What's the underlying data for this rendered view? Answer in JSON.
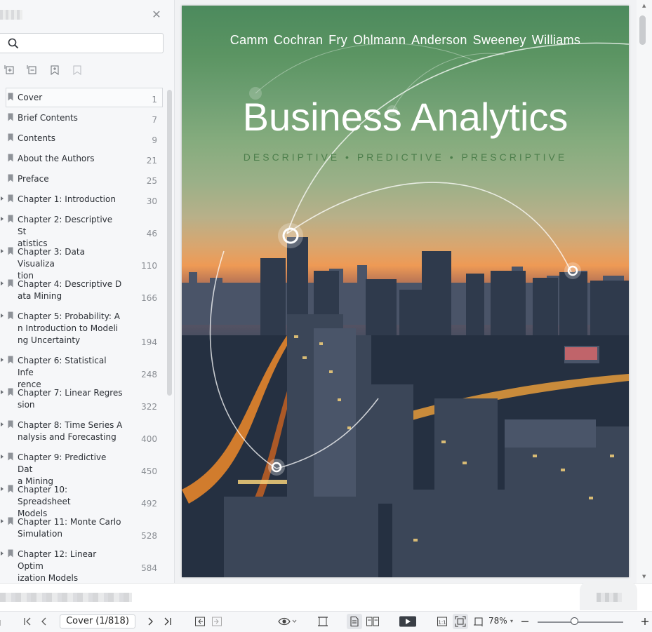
{
  "sidebar": {
    "search": {
      "value": "",
      "placeholder": ""
    },
    "outline": [
      {
        "label": "Cover",
        "page": "1",
        "expandable": false,
        "selected": true,
        "lines": 1
      },
      {
        "label": "Brief Contents",
        "page": "7",
        "expandable": false,
        "lines": 1
      },
      {
        "label": "Contents",
        "page": "9",
        "expandable": false,
        "lines": 1
      },
      {
        "label": "About the Authors",
        "page": "21",
        "expandable": false,
        "lines": 1
      },
      {
        "label": "Preface",
        "page": "25",
        "expandable": false,
        "lines": 1
      },
      {
        "label": "Chapter 1: Introduction",
        "page": "30",
        "expandable": true,
        "lines": 1
      },
      {
        "label": "Chapter 2: Descriptive St\natistics",
        "page": "46",
        "expandable": true,
        "lines": 2
      },
      {
        "label": "Chapter 3: Data Visualiza\ntion",
        "page": "110",
        "expandable": true,
        "lines": 2
      },
      {
        "label": "Chapter 4: Descriptive D\nata Mining",
        "page": "166",
        "expandable": true,
        "lines": 2
      },
      {
        "label": "Chapter 5: Probability: A\nn Introduction to Modeli\nng Uncertainty",
        "page": "194",
        "expandable": true,
        "lines": 3
      },
      {
        "label": "Chapter 6: Statistical Infe\nrence",
        "page": "248",
        "expandable": true,
        "lines": 2
      },
      {
        "label": "Chapter 7: Linear Regres\nsion",
        "page": "322",
        "expandable": true,
        "lines": 2
      },
      {
        "label": "Chapter 8: Time Series A\nnalysis and Forecasting",
        "page": "400",
        "expandable": true,
        "lines": 2
      },
      {
        "label": "Chapter 9: Predictive Dat\na Mining",
        "page": "450",
        "expandable": true,
        "lines": 2
      },
      {
        "label": "Chapter 10: Spreadsheet\nModels",
        "page": "492",
        "expandable": true,
        "lines": 2
      },
      {
        "label": "Chapter 11: Monte Carlo\nSimulation",
        "page": "528",
        "expandable": true,
        "lines": 2
      },
      {
        "label": "Chapter 12: Linear Optim\nization Models",
        "page": "584",
        "expandable": true,
        "lines": 2
      }
    ]
  },
  "cover": {
    "authors": [
      "Camm",
      "Cochran",
      "Fry",
      "Ohlmann",
      "Anderson",
      "Sweeney",
      "Williams"
    ],
    "title": "Business Analytics",
    "subtitle": "DESCRIPTIVE • PREDICTIVE • PRESCRIPTIVE"
  },
  "toolbar": {
    "page_indicator": "Cover (1/818)",
    "zoom": "78%",
    "zoom_slider_fraction": 0.43
  },
  "icons": {
    "close": "close-icon",
    "search": "search-icon",
    "expand_all": "expand-all-icon",
    "collapse_all": "collapse-all-icon",
    "add_bookmark": "add-bookmark-icon",
    "remove_bookmark": "remove-bookmark-icon",
    "bookmark": "bookmark-icon",
    "first_page": "first-page-icon",
    "prev_page": "prev-page-icon",
    "next_page": "next-page-icon",
    "last_page": "last-page-icon",
    "back": "back-icon",
    "forward": "forward-icon",
    "eye_mode": "eye-icon",
    "fit_width": "fit-width-icon",
    "single_page": "single-page-icon",
    "two_page": "two-page-icon",
    "play": "play-icon",
    "actual_size": "actual-size-icon",
    "fit_page": "fit-page-icon",
    "crop": "crop-icon",
    "zoom_in": "zoom-in-icon"
  },
  "colors": {
    "accent": "#3a3f46",
    "cover_subtitle": "#4d7f4c",
    "sidebar_bg": "#f6f7f9"
  }
}
